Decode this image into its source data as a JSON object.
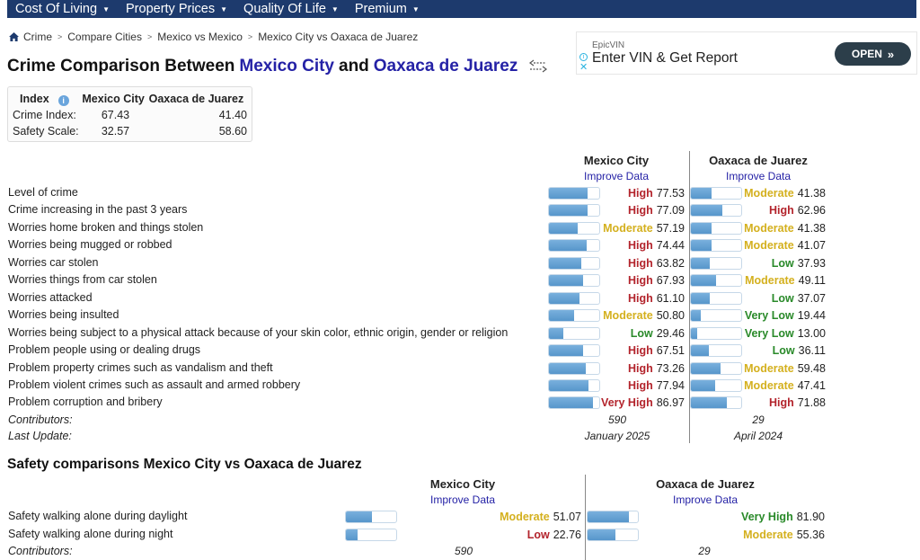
{
  "nav": {
    "items": [
      {
        "label": "Cost Of Living"
      },
      {
        "label": "Property Prices"
      },
      {
        "label": "Quality Of Life"
      },
      {
        "label": "Premium"
      }
    ]
  },
  "breadcrumb": {
    "items": [
      "Crime",
      "Compare Cities",
      "Mexico vs Mexico",
      "Mexico City vs Oaxaca de Juarez"
    ]
  },
  "title": {
    "prefix": "Crime Comparison Between",
    "city1": "Mexico City",
    "and": "and",
    "city2": "Oaxaca de Juarez"
  },
  "ad": {
    "brand": "EpicVIN",
    "text": "Enter VIN & Get Report",
    "button": "OPEN"
  },
  "index_box": {
    "header": {
      "index": "Index",
      "city1": "Mexico City",
      "city2": "Oaxaca de Juarez"
    },
    "rows": [
      {
        "label": "Crime Index:",
        "city1": "67.43",
        "city2": "41.40"
      },
      {
        "label": "Safety Scale:",
        "city1": "32.57",
        "city2": "58.60"
      }
    ]
  },
  "crime": {
    "city1": "Mexico City",
    "city2": "Oaxaca de Juarez",
    "improve": "Improve Data",
    "rows": [
      {
        "label": "Level of crime",
        "c1": {
          "level": "High",
          "value": "77.53",
          "pct": 77.53,
          "color": "red"
        },
        "c2": {
          "level": "Moderate",
          "value": "41.38",
          "pct": 41.38,
          "color": "yellow"
        }
      },
      {
        "label": "Crime increasing in the past 3 years",
        "c1": {
          "level": "High",
          "value": "77.09",
          "pct": 77.09,
          "color": "red"
        },
        "c2": {
          "level": "High",
          "value": "62.96",
          "pct": 62.96,
          "color": "red"
        }
      },
      {
        "label": "Worries home broken and things stolen",
        "c1": {
          "level": "Moderate",
          "value": "57.19",
          "pct": 57.19,
          "color": "yellow"
        },
        "c2": {
          "level": "Moderate",
          "value": "41.38",
          "pct": 41.38,
          "color": "yellow"
        }
      },
      {
        "label": "Worries being mugged or robbed",
        "c1": {
          "level": "High",
          "value": "74.44",
          "pct": 74.44,
          "color": "red"
        },
        "c2": {
          "level": "Moderate",
          "value": "41.07",
          "pct": 41.07,
          "color": "yellow"
        }
      },
      {
        "label": "Worries car stolen",
        "c1": {
          "level": "High",
          "value": "63.82",
          "pct": 63.82,
          "color": "red"
        },
        "c2": {
          "level": "Low",
          "value": "37.93",
          "pct": 37.93,
          "color": "green"
        }
      },
      {
        "label": "Worries things from car stolen",
        "c1": {
          "level": "High",
          "value": "67.93",
          "pct": 67.93,
          "color": "red"
        },
        "c2": {
          "level": "Moderate",
          "value": "49.11",
          "pct": 49.11,
          "color": "yellow"
        }
      },
      {
        "label": "Worries attacked",
        "c1": {
          "level": "High",
          "value": "61.10",
          "pct": 61.1,
          "color": "red"
        },
        "c2": {
          "level": "Low",
          "value": "37.07",
          "pct": 37.07,
          "color": "green"
        }
      },
      {
        "label": "Worries being insulted",
        "c1": {
          "level": "Moderate",
          "value": "50.80",
          "pct": 50.8,
          "color": "yellow"
        },
        "c2": {
          "level": "Very Low",
          "value": "19.44",
          "pct": 19.44,
          "color": "green"
        }
      },
      {
        "label": "Worries being subject to a physical attack because of your skin color, ethnic origin, gender or religion",
        "c1": {
          "level": "Low",
          "value": "29.46",
          "pct": 29.46,
          "color": "green"
        },
        "c2": {
          "level": "Very Low",
          "value": "13.00",
          "pct": 13.0,
          "color": "green"
        }
      },
      {
        "label": "Problem people using or dealing drugs",
        "c1": {
          "level": "High",
          "value": "67.51",
          "pct": 67.51,
          "color": "red"
        },
        "c2": {
          "level": "Low",
          "value": "36.11",
          "pct": 36.11,
          "color": "green"
        }
      },
      {
        "label": "Problem property crimes such as vandalism and theft",
        "c1": {
          "level": "High",
          "value": "73.26",
          "pct": 73.26,
          "color": "red"
        },
        "c2": {
          "level": "Moderate",
          "value": "59.48",
          "pct": 59.48,
          "color": "yellow"
        }
      },
      {
        "label": "Problem violent crimes such as assault and armed robbery",
        "c1": {
          "level": "High",
          "value": "77.94",
          "pct": 77.94,
          "color": "red"
        },
        "c2": {
          "level": "Moderate",
          "value": "47.41",
          "pct": 47.41,
          "color": "yellow"
        }
      },
      {
        "label": "Problem corruption and bribery",
        "c1": {
          "level": "Very High",
          "value": "86.97",
          "pct": 86.97,
          "color": "red"
        },
        "c2": {
          "level": "High",
          "value": "71.88",
          "pct": 71.88,
          "color": "red"
        }
      }
    ],
    "contributors_label": "Contributors:",
    "contributors": {
      "c1": "590",
      "c2": "29"
    },
    "last_update_label": "Last Update:",
    "last_update": {
      "c1": "January 2025",
      "c2": "April 2024"
    }
  },
  "safety": {
    "title": "Safety comparisons Mexico City vs Oaxaca de Juarez",
    "city1": "Mexico City",
    "city2": "Oaxaca de Juarez",
    "improve": "Improve Data",
    "rows": [
      {
        "label": "Safety walking alone during daylight",
        "c1": {
          "level": "Moderate",
          "value": "51.07",
          "pct": 51.07,
          "color": "yellow"
        },
        "c2": {
          "level": "Very High",
          "value": "81.90",
          "pct": 81.9,
          "color": "green"
        }
      },
      {
        "label": "Safety walking alone during night",
        "c1": {
          "level": "Low",
          "value": "22.76",
          "pct": 22.76,
          "color": "red"
        },
        "c2": {
          "level": "Moderate",
          "value": "55.36",
          "pct": 55.36,
          "color": "yellow"
        }
      }
    ],
    "contributors_label": "Contributors:",
    "contributors": {
      "c1": "590",
      "c2": "29"
    }
  },
  "colors": {
    "nav_bg": "#1d3a6d",
    "city_link": "#2522a6",
    "red": "#b3242c",
    "yellow": "#d4b01e",
    "green": "#2a8a2a",
    "bar_fill": "#5f9fd4"
  }
}
